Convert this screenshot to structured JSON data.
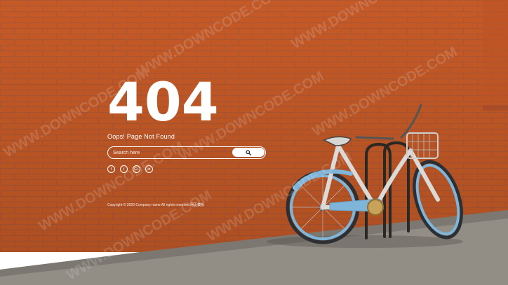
{
  "error": {
    "code": "404",
    "message": "Oops! Page Not Found"
  },
  "search": {
    "placeholder": "Search here",
    "button_icon": "search-icon"
  },
  "social": [
    {
      "icon": "facebook-icon",
      "glyph": "f"
    },
    {
      "icon": "twitter-icon",
      "glyph": "t"
    },
    {
      "icon": "google-plus-icon",
      "glyph": "G+"
    },
    {
      "icon": "linkedin-icon",
      "glyph": "in"
    }
  ],
  "footer": {
    "copyright": "Copyright © 2020 Company name All rights reserved.网页模板"
  },
  "colors": {
    "brick": "#c45a27",
    "mortar": "#b9683f",
    "pavement": "#8f8a82",
    "bike_blue": "#7fb5d8"
  }
}
